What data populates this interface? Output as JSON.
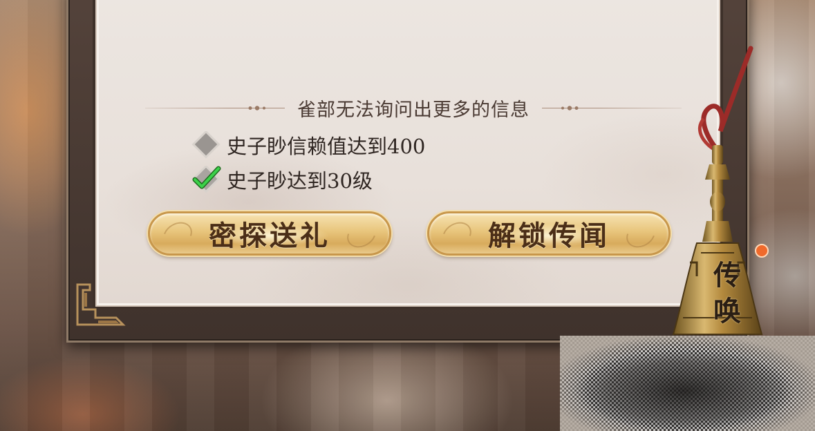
{
  "dialog": {
    "section_heading": "雀部无法询问出更多的信息",
    "conditions": [
      {
        "text": "史子眇信赖值达到400",
        "met": false
      },
      {
        "text": "史子眇达到30级",
        "met": true
      }
    ],
    "buttons": {
      "secret_gift": "密探送礼",
      "unlock_rumor": "解锁传闻"
    }
  },
  "bell": {
    "line1": "传",
    "line2": "唤",
    "has_notification": true
  },
  "colors": {
    "accent_gold": "#e8c57c",
    "check_green": "#3cd24a",
    "notification_dot": "#f06a2b",
    "panel_bg": "#ece6e1"
  },
  "icons": {
    "unmet_condition": "grey-diamond-icon",
    "met_condition": "check-diamond-icon",
    "summon": "bronze-bell-icon"
  }
}
